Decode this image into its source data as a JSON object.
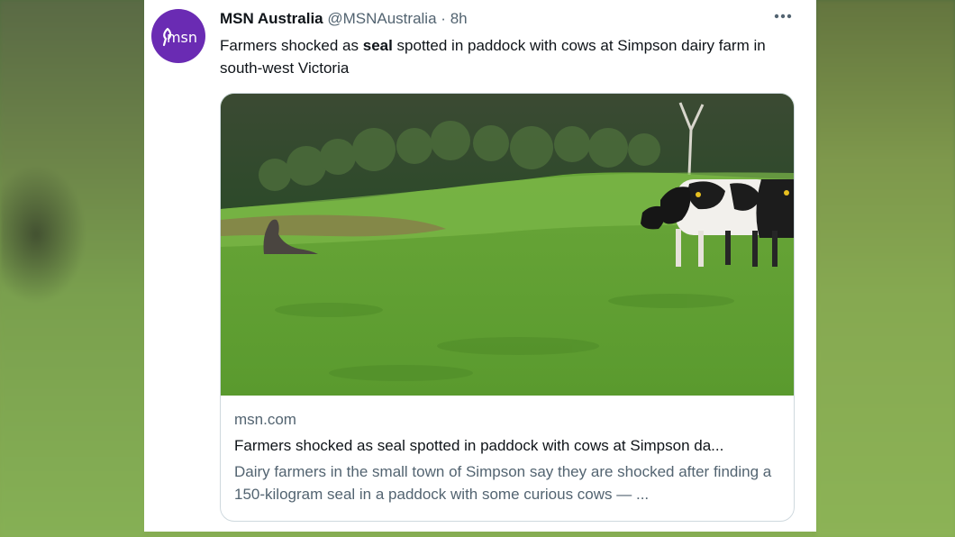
{
  "tweet": {
    "avatar_text": "msn",
    "author_name": "MSN Australia",
    "author_handle": "@MSNAustralia",
    "separator": "·",
    "time": "8h",
    "more_label": "•••",
    "text_before": "Farmers shocked as ",
    "text_bold": "seal",
    "text_after": " spotted in paddock with cows at Simpson dairy farm in south-west Victoria"
  },
  "link_card": {
    "domain": "msn.com",
    "title": "Farmers shocked as seal spotted in paddock with cows at Simpson da...",
    "description": "Dairy farmers in the small town of Simpson say they are shocked after finding a 150-kilogram seal in a paddock with some curious cows — ..."
  },
  "colors": {
    "brand_purple": "#6a2bb3",
    "secondary_text": "#536471",
    "primary_text": "#0f1419"
  }
}
